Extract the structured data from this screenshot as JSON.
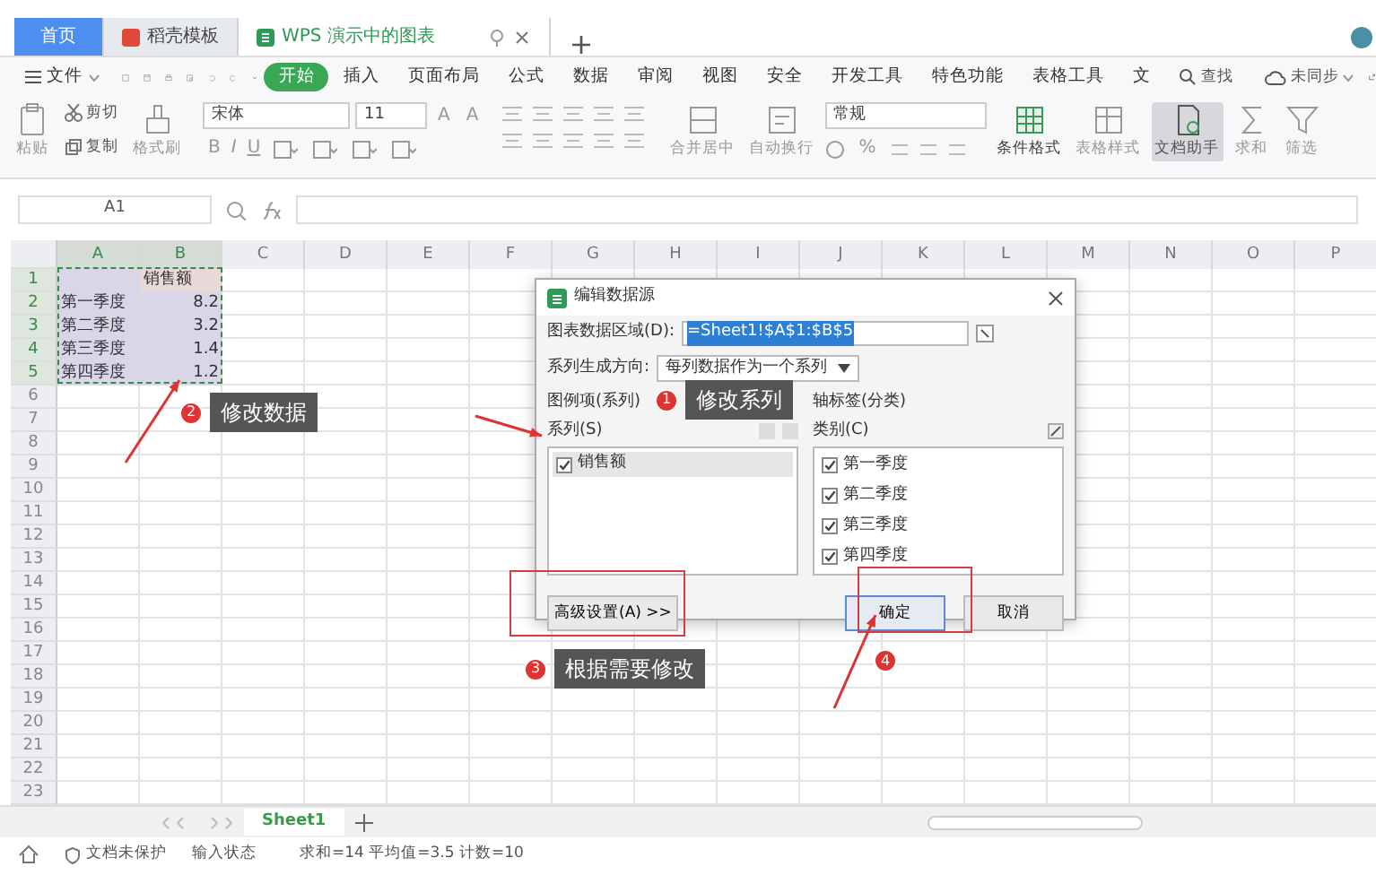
{
  "tabs": [
    {
      "label": "首页",
      "selected": false,
      "kind": "home"
    },
    {
      "label": "稻壳模板",
      "selected": false,
      "kind": "docer"
    },
    {
      "label": "WPS 演示中的图表",
      "selected": true,
      "kind": "sheet"
    }
  ],
  "menu": {
    "file": "文件",
    "items": [
      {
        "label": "开始",
        "selected": true
      },
      {
        "label": "插入",
        "selected": false
      },
      {
        "label": "页面布局",
        "selected": false
      },
      {
        "label": "公式",
        "selected": false
      },
      {
        "label": "数据",
        "selected": false
      },
      {
        "label": "审阅",
        "selected": false
      },
      {
        "label": "视图",
        "selected": false
      },
      {
        "label": "安全",
        "selected": false
      },
      {
        "label": "开发工具",
        "selected": false
      },
      {
        "label": "特色功能",
        "selected": false
      },
      {
        "label": "表格工具",
        "selected": false
      },
      {
        "label": "文",
        "selected": false
      }
    ],
    "search": "查找",
    "sync": "未同步"
  },
  "ribbon": {
    "paste": "粘贴",
    "cut": "剪切",
    "copy": "复制",
    "format_painter": "格式刷",
    "font": "宋体",
    "size": "11",
    "size_buttons": [
      "A",
      "A"
    ],
    "style_buttons": [
      "B",
      "I",
      "U"
    ],
    "merge": "合并居中",
    "wrap": "自动换行",
    "number_format": "常规",
    "percent": "%",
    "conditional": "条件格式",
    "table_style": "表格样式",
    "assistant": "文档助手",
    "sum": "求和",
    "filter": "筛选"
  },
  "formula_bar": {
    "name_box": "A1"
  },
  "sheet": {
    "columns": [
      {
        "label": "A",
        "selected": true
      },
      {
        "label": "B",
        "selected": true
      },
      {
        "label": "C",
        "selected": false
      },
      {
        "label": "D",
        "selected": false
      },
      {
        "label": "E",
        "selected": false
      },
      {
        "label": "F",
        "selected": false
      },
      {
        "label": "G",
        "selected": false
      },
      {
        "label": "H",
        "selected": false
      },
      {
        "label": "I",
        "selected": false
      },
      {
        "label": "J",
        "selected": false
      },
      {
        "label": "K",
        "selected": false
      },
      {
        "label": "L",
        "selected": false
      },
      {
        "label": "M",
        "selected": false
      },
      {
        "label": "N",
        "selected": false
      },
      {
        "label": "O",
        "selected": false
      },
      {
        "label": "P",
        "selected": false
      }
    ],
    "rows": [
      {
        "label": "1",
        "selected": true,
        "cells": [
          "",
          "销售额"
        ]
      },
      {
        "label": "2",
        "selected": true,
        "cells": [
          "第一季度",
          "8.2"
        ]
      },
      {
        "label": "3",
        "selected": true,
        "cells": [
          "第二季度",
          "3.2"
        ]
      },
      {
        "label": "4",
        "selected": true,
        "cells": [
          "第三季度",
          "1.4"
        ]
      },
      {
        "label": "5",
        "selected": true,
        "cells": [
          "第四季度",
          "1.2"
        ]
      },
      {
        "label": "6",
        "selected": false
      },
      {
        "label": "7",
        "selected": false
      },
      {
        "label": "8",
        "selected": false
      },
      {
        "label": "9",
        "selected": false
      },
      {
        "label": "10",
        "selected": false
      },
      {
        "label": "11",
        "selected": false
      },
      {
        "label": "12",
        "selected": false
      },
      {
        "label": "13",
        "selected": false
      },
      {
        "label": "14",
        "selected": false
      },
      {
        "label": "15",
        "selected": false
      },
      {
        "label": "16",
        "selected": false
      },
      {
        "label": "17",
        "selected": false
      },
      {
        "label": "18",
        "selected": false
      },
      {
        "label": "19",
        "selected": false
      },
      {
        "label": "20",
        "selected": false
      },
      {
        "label": "21",
        "selected": false
      },
      {
        "label": "22",
        "selected": false
      },
      {
        "label": "23",
        "selected": false
      }
    ]
  },
  "sheet_tabs": [
    {
      "label": "Sheet1",
      "selected": true
    }
  ],
  "status_bar": [
    "文档未保护",
    "输入状态",
    "求和=14 平均值=3.5 计数=10"
  ],
  "dialog": {
    "title": "编辑数据源",
    "range_label": "图表数据区域(D):",
    "range_value": "=Sheet1!$A$1:$B$5",
    "direction_label": "系列生成方向:",
    "direction_value": "每列数据作为一个系列",
    "legend_title": "图例项(系列)",
    "series_label": "系列(S)",
    "series": [
      {
        "label": "销售额",
        "checked": true,
        "selected": true
      }
    ],
    "axis_title": "轴标签(分类)",
    "category_label": "类别(C)",
    "categories": [
      {
        "label": "第一季度",
        "checked": true
      },
      {
        "label": "第二季度",
        "checked": true
      },
      {
        "label": "第三季度",
        "checked": true
      },
      {
        "label": "第四季度",
        "checked": true
      }
    ],
    "advanced": "高级设置(A) >>",
    "ok": "确定",
    "cancel": "取消"
  },
  "annotations": [
    {
      "number": "2",
      "text": "修改数据"
    },
    {
      "number": "1",
      "text": "修改系列"
    },
    {
      "number": "3",
      "text": "根据需要修改"
    },
    {
      "number": "4"
    }
  ]
}
